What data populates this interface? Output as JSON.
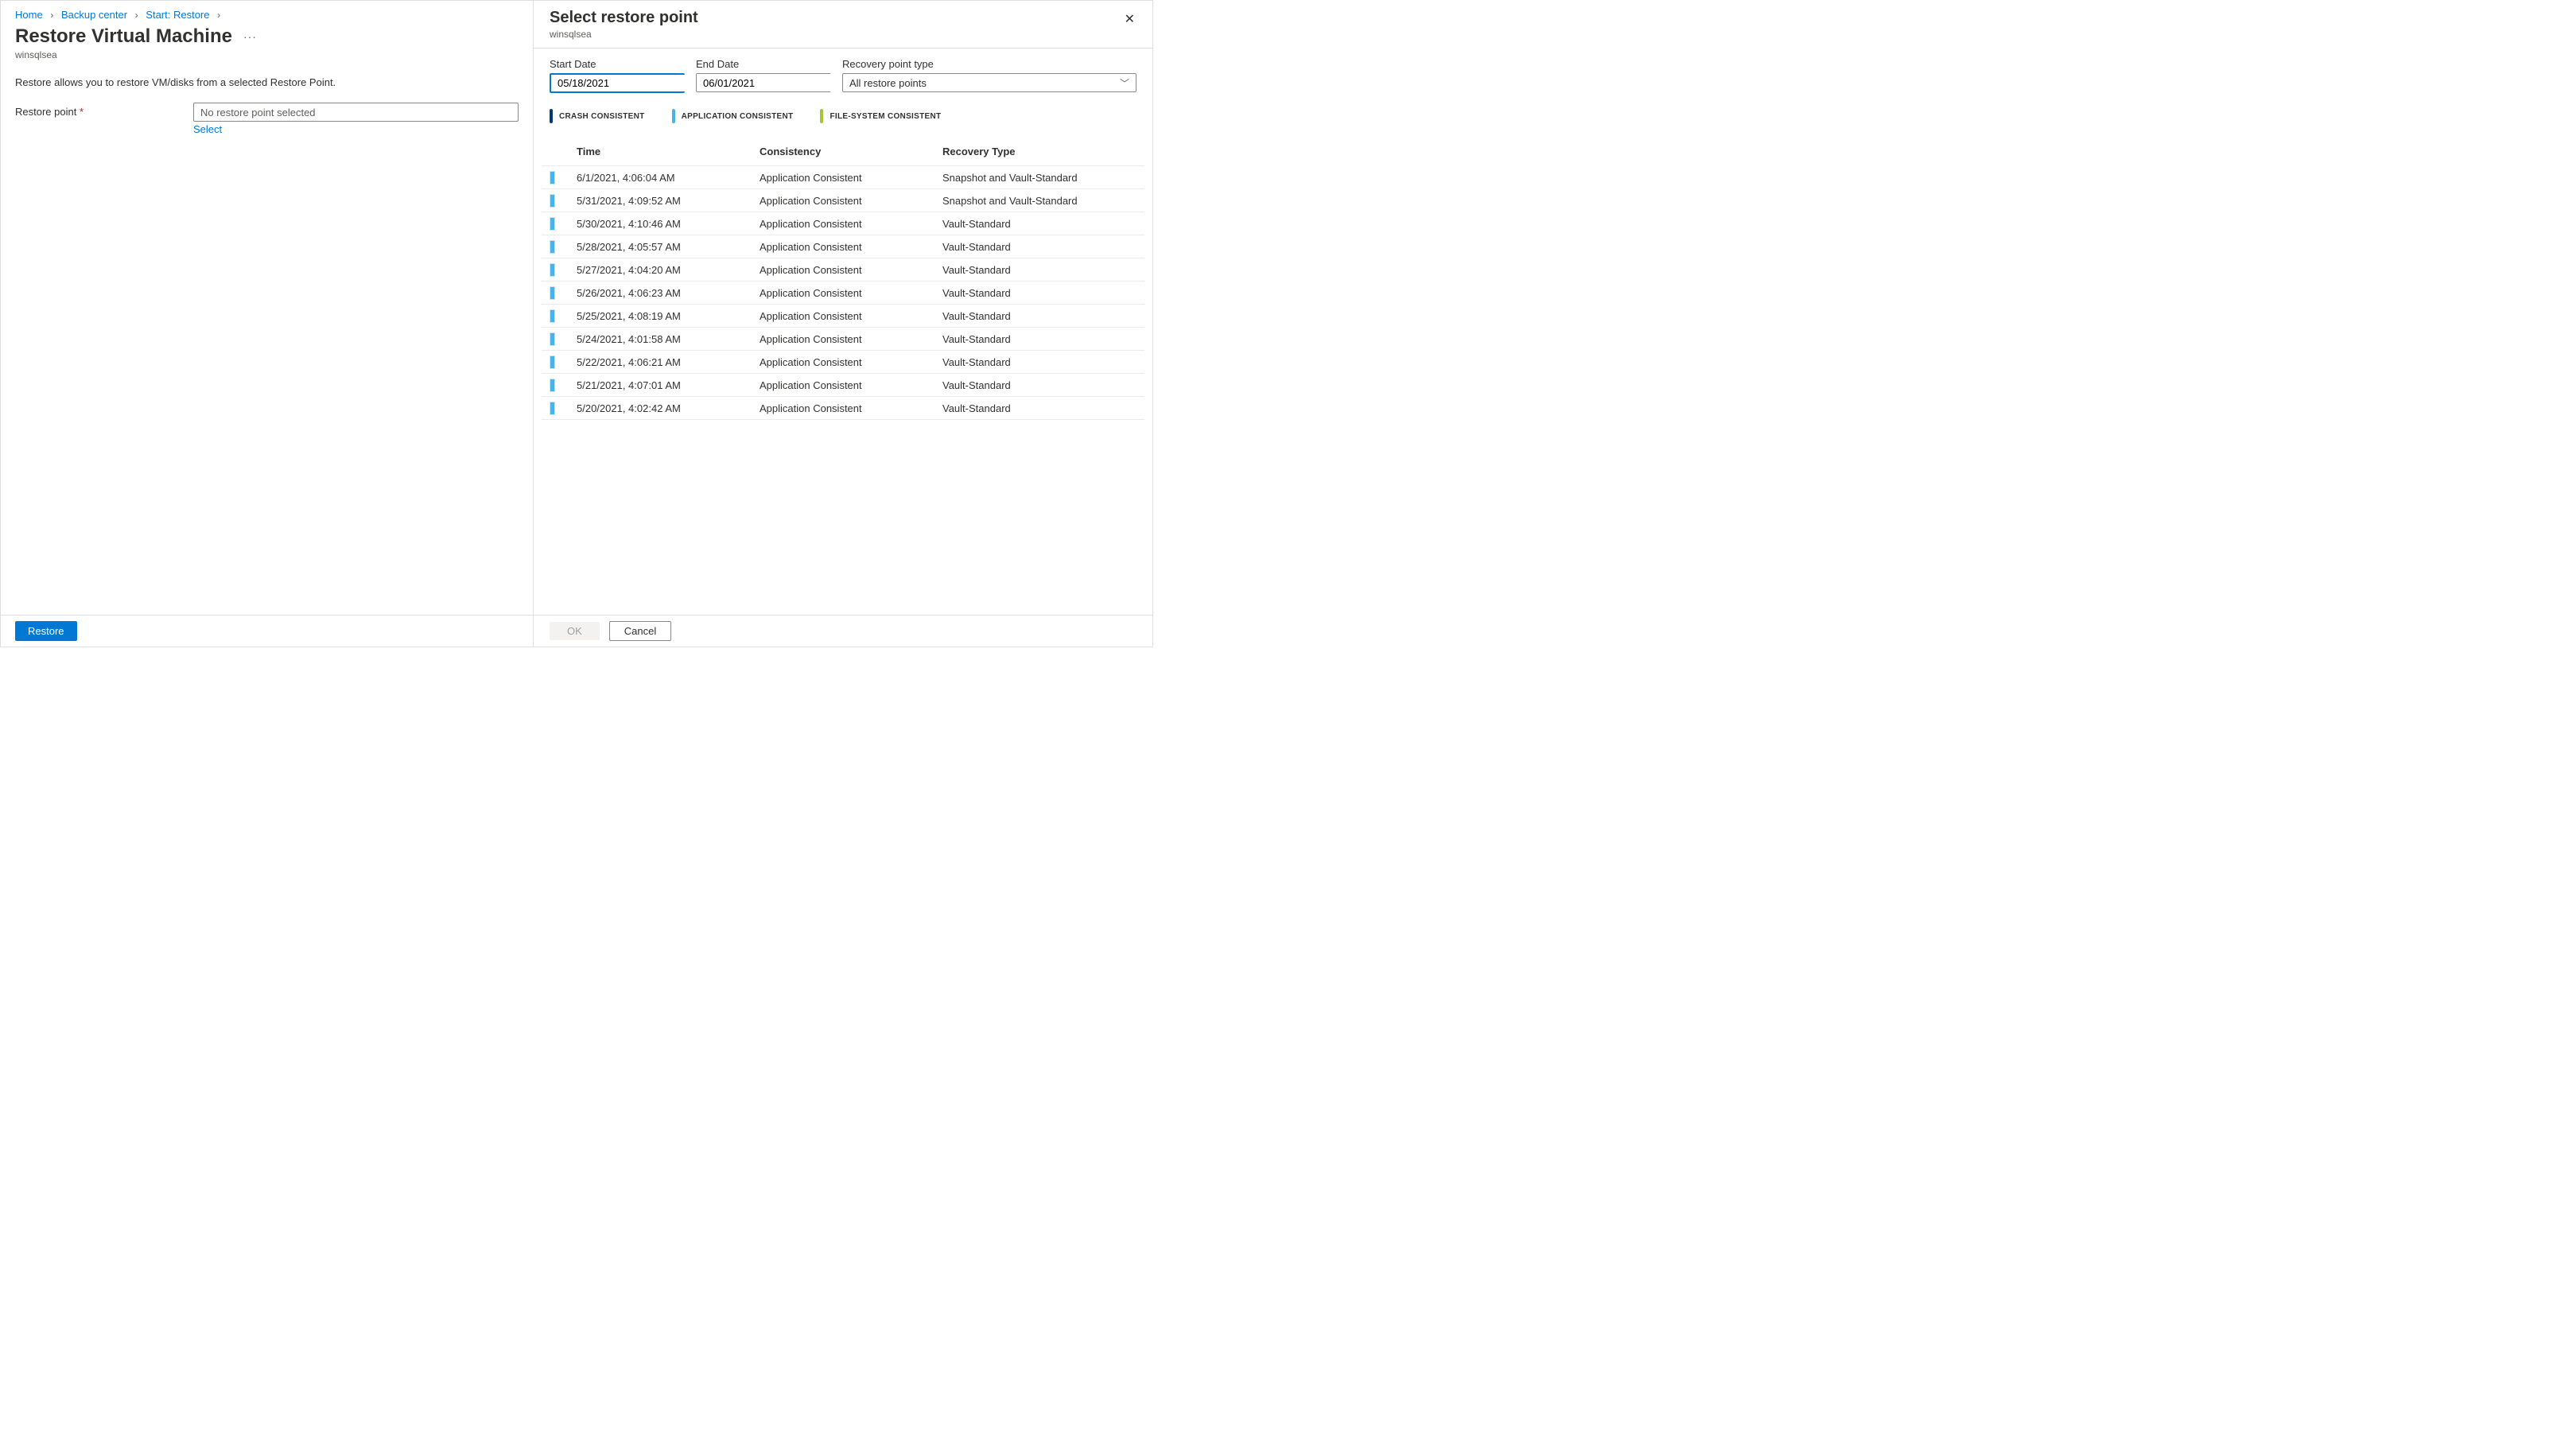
{
  "breadcrumb": {
    "home": "Home",
    "backup_center": "Backup center",
    "start_restore": "Start: Restore"
  },
  "main": {
    "title": "Restore Virtual Machine",
    "subtitle": "winsqlsea",
    "description": "Restore allows you to restore VM/disks from a selected Restore Point.",
    "field_label": "Restore point",
    "field_value": "No restore point selected",
    "select_link": "Select",
    "restore_btn": "Restore"
  },
  "panel": {
    "title": "Select restore point",
    "subtitle": "winsqlsea",
    "start_date_label": "Start Date",
    "start_date_value": "05/18/2021",
    "end_date_label": "End Date",
    "end_date_value": "06/01/2021",
    "rp_type_label": "Recovery point type",
    "rp_type_value": "All restore points",
    "legend": {
      "crash": "CRASH CONSISTENT",
      "app": "APPLICATION CONSISTENT",
      "file": "FILE-SYSTEM CONSISTENT"
    },
    "columns": {
      "time": "Time",
      "consistency": "Consistency",
      "recovery_type": "Recovery Type"
    },
    "rows": [
      {
        "time": "6/1/2021, 4:06:04 AM",
        "consistency": "Application Consistent",
        "recovery_type": "Snapshot and Vault-Standard"
      },
      {
        "time": "5/31/2021, 4:09:52 AM",
        "consistency": "Application Consistent",
        "recovery_type": "Snapshot and Vault-Standard"
      },
      {
        "time": "5/30/2021, 4:10:46 AM",
        "consistency": "Application Consistent",
        "recovery_type": "Vault-Standard"
      },
      {
        "time": "5/28/2021, 4:05:57 AM",
        "consistency": "Application Consistent",
        "recovery_type": "Vault-Standard"
      },
      {
        "time": "5/27/2021, 4:04:20 AM",
        "consistency": "Application Consistent",
        "recovery_type": "Vault-Standard"
      },
      {
        "time": "5/26/2021, 4:06:23 AM",
        "consistency": "Application Consistent",
        "recovery_type": "Vault-Standard"
      },
      {
        "time": "5/25/2021, 4:08:19 AM",
        "consistency": "Application Consistent",
        "recovery_type": "Vault-Standard"
      },
      {
        "time": "5/24/2021, 4:01:58 AM",
        "consistency": "Application Consistent",
        "recovery_type": "Vault-Standard"
      },
      {
        "time": "5/22/2021, 4:06:21 AM",
        "consistency": "Application Consistent",
        "recovery_type": "Vault-Standard"
      },
      {
        "time": "5/21/2021, 4:07:01 AM",
        "consistency": "Application Consistent",
        "recovery_type": "Vault-Standard"
      },
      {
        "time": "5/20/2021, 4:02:42 AM",
        "consistency": "Application Consistent",
        "recovery_type": "Vault-Standard"
      }
    ],
    "ok_btn": "OK",
    "cancel_btn": "Cancel"
  }
}
